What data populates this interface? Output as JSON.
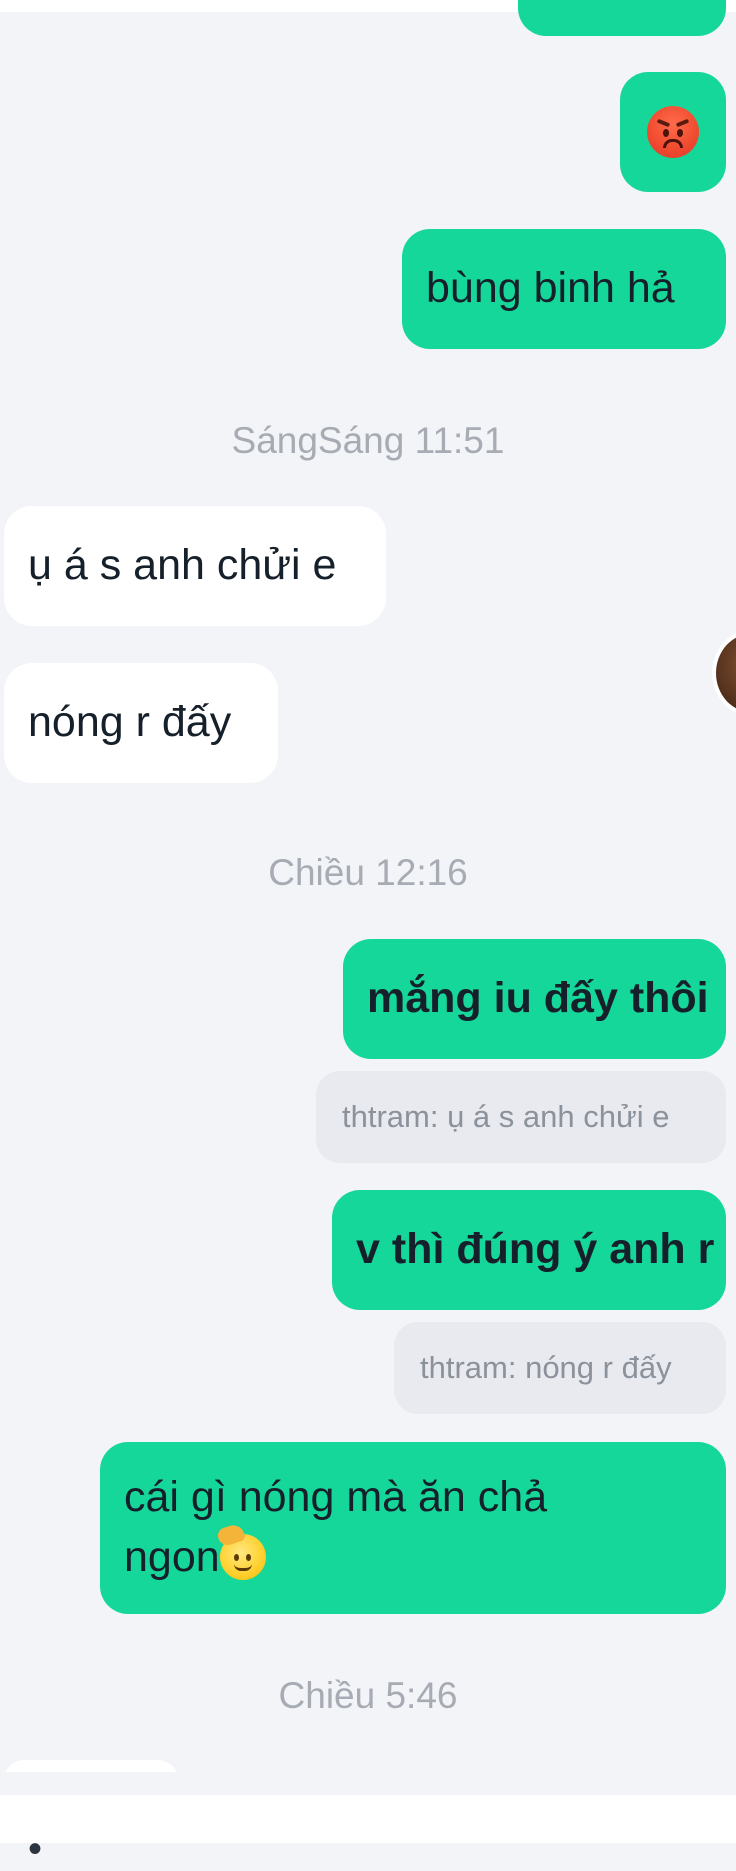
{
  "messages": {
    "m1": {
      "text": "bùng binh hả"
    },
    "m2": {
      "text": "ụ á s anh chửi e"
    },
    "m3": {
      "text": "nóng r đấy"
    },
    "m4": {
      "text": "mắng iu đấy thôi"
    },
    "m4_quote": {
      "text": "thtram: ụ á s anh chửi e"
    },
    "m5": {
      "text": "v thì đúng ý anh r"
    },
    "m5_quote": {
      "text": "thtram: nóng r đấy"
    },
    "m6": {
      "line1": "cái gì nóng mà ăn chả",
      "line2": "ngon"
    }
  },
  "timestamps": {
    "t1": "SángSáng 11:51",
    "t2": "Chiều 12:16",
    "t3": "Chiều 5:46"
  },
  "icons": {
    "reaction_emoji": "angry-face-emoji",
    "inline_emoji": "saluting-face-emoji"
  },
  "colors": {
    "sent_bubble": "#16d79a",
    "received_bubble": "#ffffff",
    "background": "#f3f4f7",
    "quote_bubble": "#e9eaef",
    "timestamp_text": "#a6abb4"
  }
}
